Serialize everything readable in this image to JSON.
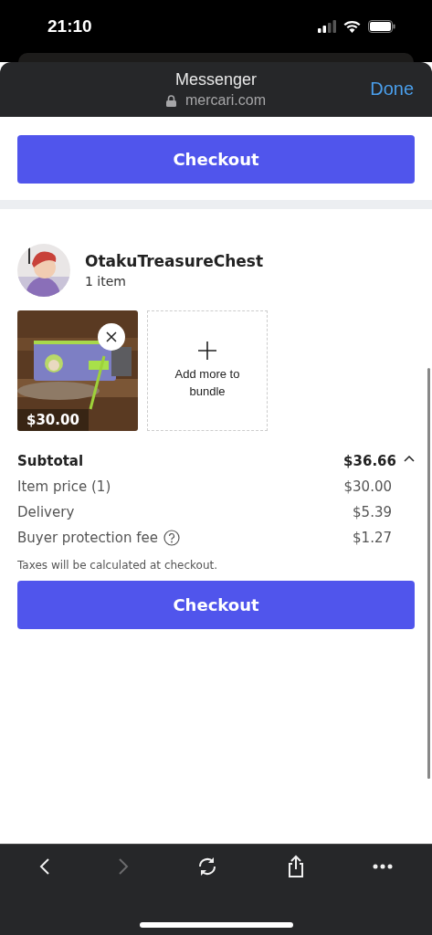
{
  "status_bar": {
    "time": "21:10"
  },
  "browser_header": {
    "title": "Messenger",
    "url": "mercari.com",
    "done": "Done"
  },
  "top_checkout": {
    "button": "Checkout"
  },
  "seller": {
    "name": "OtakuTreasureChest",
    "count": "1 item"
  },
  "items": [
    {
      "kind": "picture",
      "price": "$30.00"
    }
  ],
  "add_more": {
    "label": "Add more to bundle"
  },
  "subtotal": {
    "label": "Subtotal",
    "value": "$36.66",
    "expanded": true
  },
  "lines": [
    {
      "label": "Item price (1)",
      "value": "$30.00",
      "info": false
    },
    {
      "label": "Delivery",
      "value": "$5.39",
      "info": false
    },
    {
      "label": "Buyer protection fee",
      "value": "$1.27",
      "info": true
    }
  ],
  "note": "Taxes will be calculated at checkout.",
  "checkout": {
    "button": "Checkout"
  },
  "toolbar": {
    "back_disabled": false,
    "forward_disabled": true
  }
}
